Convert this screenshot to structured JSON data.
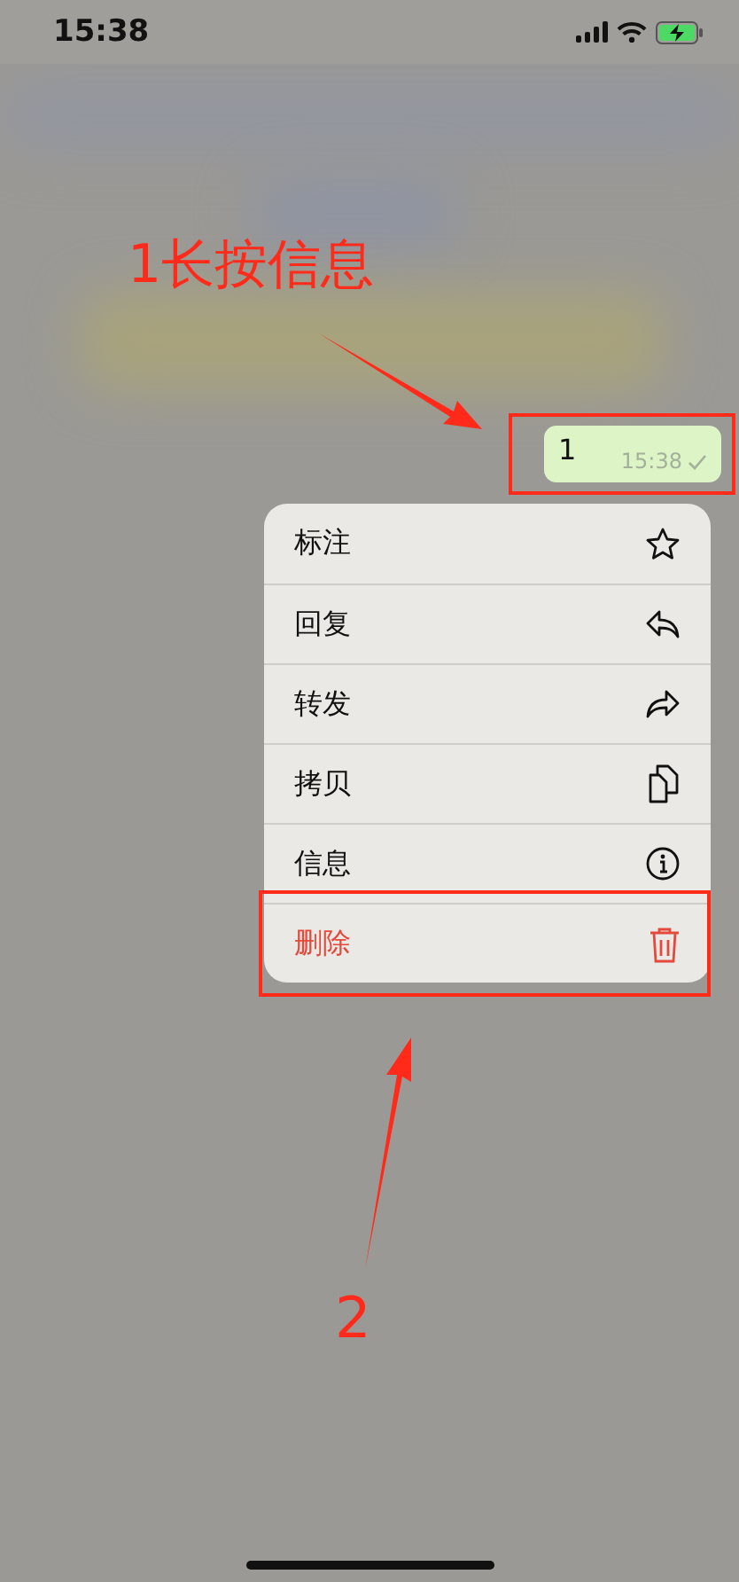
{
  "status_bar": {
    "time": "15:38"
  },
  "message": {
    "text": "1",
    "time": "15:38",
    "delivered": true
  },
  "menu": {
    "items": [
      {
        "label": "标注",
        "kind": "normal"
      },
      {
        "label": "回复",
        "kind": "normal"
      },
      {
        "label": "转发",
        "kind": "normal"
      },
      {
        "label": "拷贝",
        "kind": "normal"
      },
      {
        "label": "信息",
        "kind": "normal"
      },
      {
        "label": "删除",
        "kind": "destructive"
      }
    ]
  },
  "annotations": [
    {
      "text": "1长按信息"
    },
    {
      "text": "2"
    }
  ]
}
